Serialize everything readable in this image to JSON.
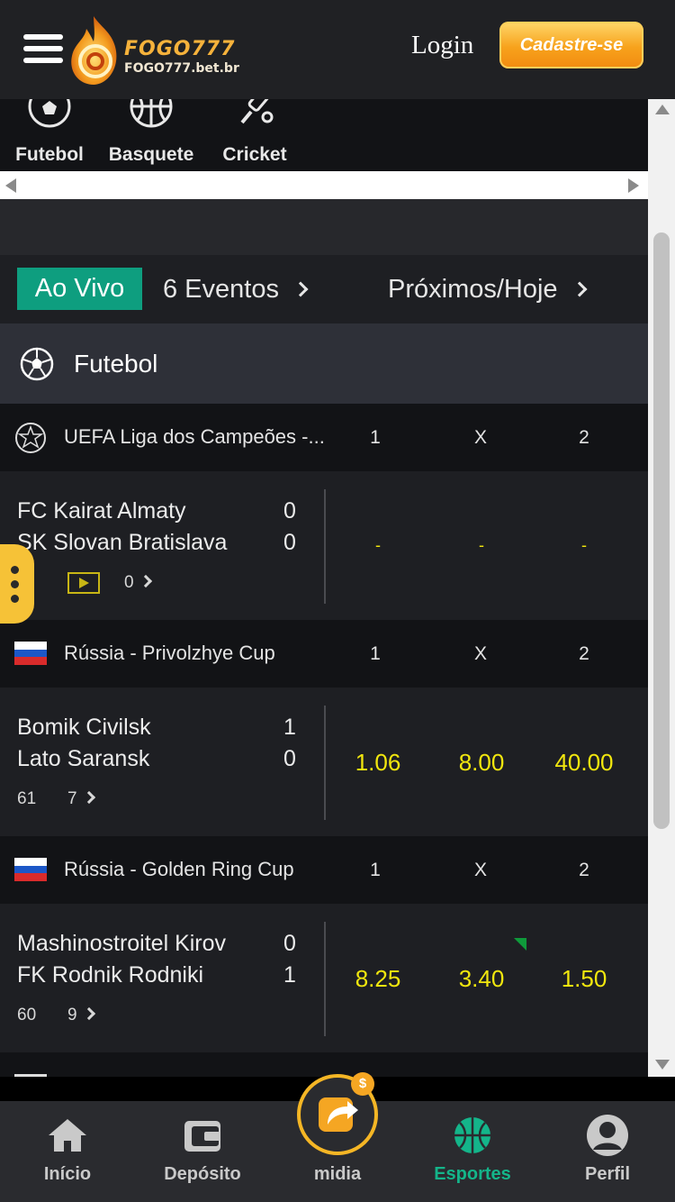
{
  "header": {
    "logo_text": "FOGO777",
    "logo_sub": "FOGO777.bet.br",
    "login_label": "Login",
    "signup_label": "Cadastre-se"
  },
  "categories": [
    {
      "label": "Futebol",
      "icon": "soccer-ball-icon"
    },
    {
      "label": "Basquete",
      "icon": "basketball-icon"
    },
    {
      "label": "Cricket",
      "icon": "cricket-bat-icon"
    }
  ],
  "livebar": {
    "live_label": "Ao Vivo",
    "events_label": "6 Eventos",
    "upcoming_label": "Próximos/Hoje"
  },
  "sport_header": {
    "name": "Futebol"
  },
  "odds_headers": {
    "h1": "1",
    "hx": "X",
    "h2": "2"
  },
  "leagues": [
    {
      "name": "UEFA Liga dos Campeões -...",
      "match": {
        "home": "FC Kairat Almaty",
        "home_score": "0",
        "away": "SK Slovan Bratislava",
        "away_score": "0",
        "minute": "",
        "more": "0",
        "odds": [
          "-",
          "-",
          "-"
        ]
      }
    },
    {
      "name": "Rússia - Privolzhye Cup",
      "match": {
        "home": "Bomik Civilsk",
        "home_score": "1",
        "away": "Lato Saransk",
        "away_score": "0",
        "minute": "61",
        "more": "7",
        "odds": [
          "1.06",
          "8.00",
          "40.00"
        ]
      }
    },
    {
      "name": "Rússia - Golden Ring Cup",
      "match": {
        "home": "Mashinostroitel Kirov",
        "home_score": "0",
        "away": "FK Rodnik Rodniki",
        "away_score": "1",
        "minute": "60",
        "more": "9",
        "odds": [
          "8.25",
          "3.40",
          "1.50"
        ]
      }
    }
  ],
  "bottom_nav": [
    {
      "label": "Início",
      "icon": "home-icon"
    },
    {
      "label": "Depósito",
      "icon": "wallet-icon"
    },
    {
      "label": "midia",
      "icon": "share-icon"
    },
    {
      "label": "Esportes",
      "icon": "basketball-icon"
    },
    {
      "label": "Perfil",
      "icon": "profile-icon"
    }
  ],
  "colors": {
    "accent_green": "#0e9e7f",
    "odds_yellow": "#f1e60e",
    "brand_orange": "#f5b625"
  },
  "coin_symbol": "$"
}
